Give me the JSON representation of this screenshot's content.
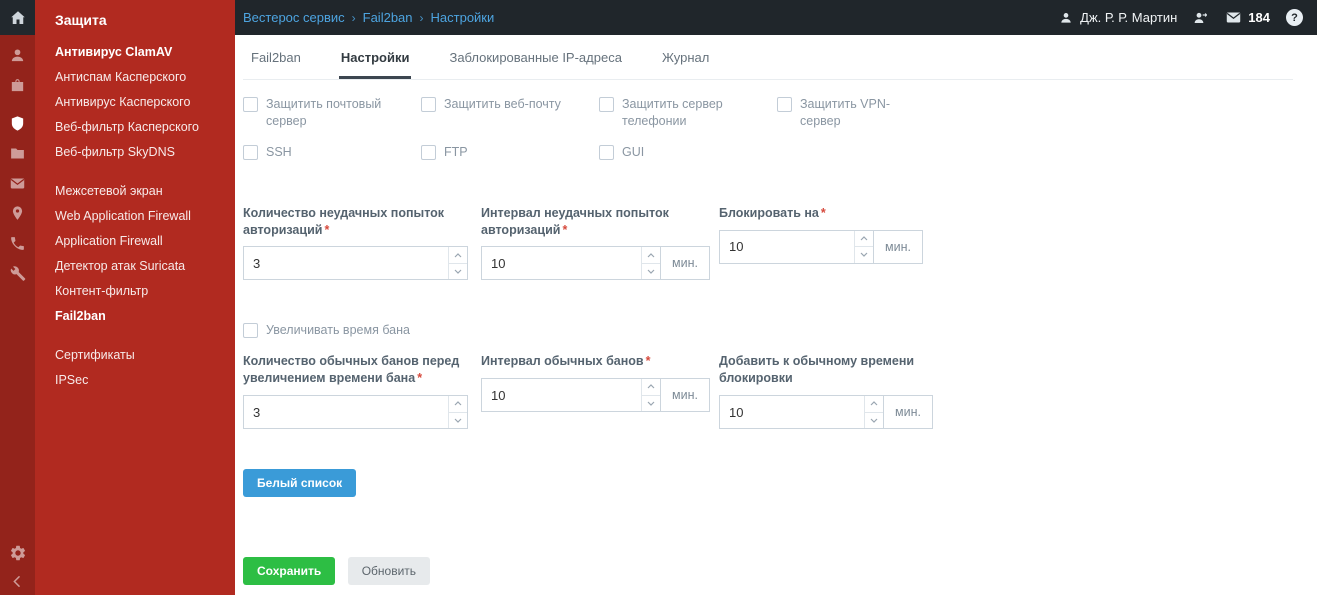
{
  "colors": {
    "sidebar_red": "#b12a20",
    "rail_red": "#93231b",
    "topbar_dark": "#20262b",
    "link_blue": "#4da4e0",
    "button_blue": "#3a9bd8",
    "save_green": "#2dbe44",
    "required_red": "#d6493c"
  },
  "topbar": {
    "breadcrumb": [
      "Вестерос сервис",
      "Fail2ban",
      "Настройки"
    ],
    "separator": "›",
    "user_name": "Дж. Р. Р. Мартин",
    "mail_count": "184",
    "help_mark": "?"
  },
  "sidebar": {
    "title": "Защита",
    "group1": [
      "Антивирус ClamAV",
      "Антиспам Касперского",
      "Антивирус Касперского",
      "Веб-фильтр Касперского",
      "Веб-фильтр SkyDNS"
    ],
    "group2": [
      "Межсетевой экран",
      "Web Application Firewall",
      "Application Firewall",
      "Детектор атак Suricata",
      "Контент-фильтр",
      "Fail2ban"
    ],
    "group3": [
      "Сертификаты",
      "IPSec"
    ]
  },
  "tabs": {
    "items": [
      "Fail2ban",
      "Настройки",
      "Заблокированные IP-адреса",
      "Журнал"
    ],
    "active": "Настройки"
  },
  "protect": {
    "row1": [
      "Защитить почтовый сервер",
      "Защитить веб-почту",
      "Защитить сервер телефонии",
      "Защитить VPN-сервер"
    ],
    "row2": [
      "SSH",
      "FTP",
      "GUI"
    ]
  },
  "form": {
    "required_mark": "*",
    "minutes_suffix": "мин.",
    "attempts": {
      "label": "Количество неудачных попыток авторизаций",
      "value": "3"
    },
    "attempts_interval": {
      "label": "Интервал неудачных попыток авторизаций",
      "value": "10"
    },
    "block_for": {
      "label": "Блокировать на",
      "value": "10"
    },
    "increase_ban": "Увеличивать время бана",
    "bans_before": {
      "label": "Количество обычных банов перед увеличением времени бана",
      "value": "3"
    },
    "bans_interval": {
      "label": "Интервал обычных банов",
      "value": "10"
    },
    "add_time": {
      "label": "Добавить к обычному времени блокировки",
      "value": "10"
    },
    "whitelist_button": "Белый список"
  },
  "actions": {
    "save": "Сохранить",
    "refresh": "Обновить"
  }
}
